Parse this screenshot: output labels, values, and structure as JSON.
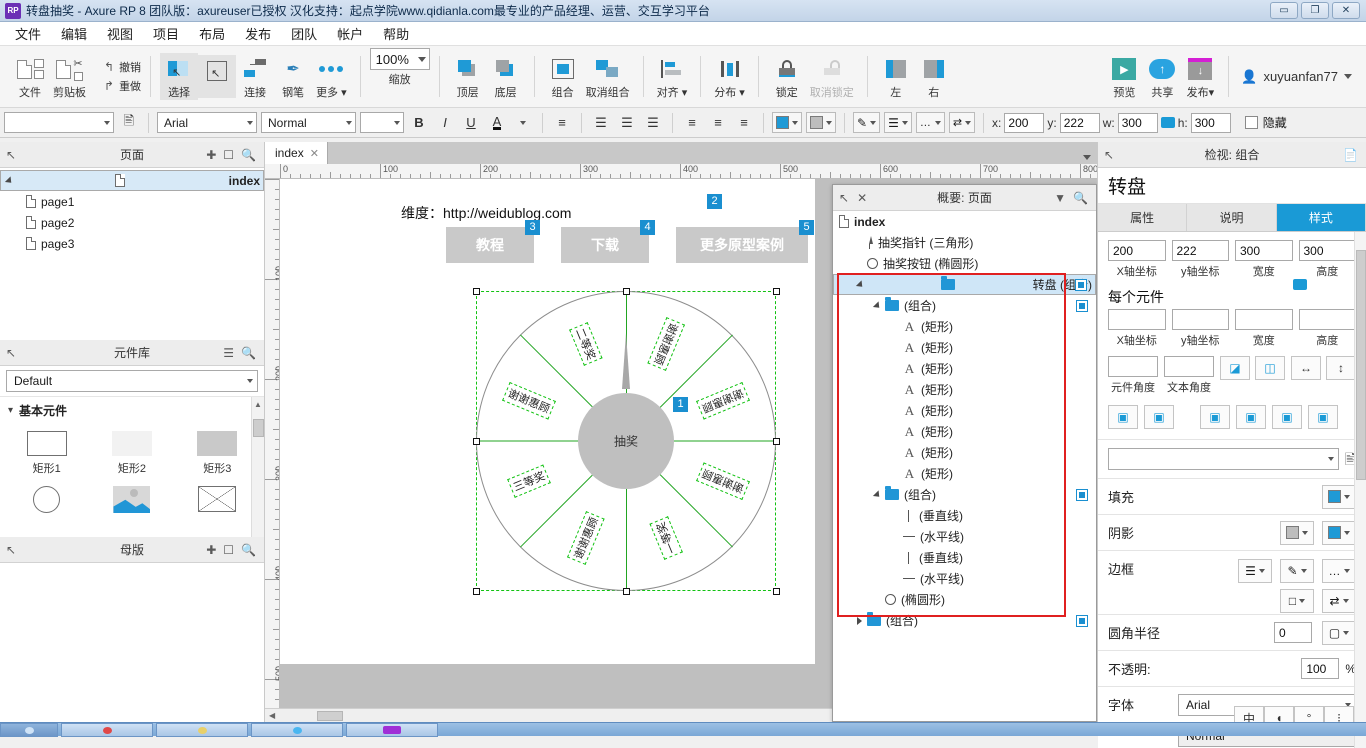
{
  "window": {
    "app_icon": "RP",
    "title": "转盘抽奖 - Axure RP 8 团队版：axureuser已授权 汉化支持：起点学院www.qidianla.com最专业的产品经理、运营、交互学习平台",
    "minimize": "—",
    "maximize": "❐",
    "close": "✕"
  },
  "menu": [
    "文件",
    "编辑",
    "视图",
    "项目",
    "布局",
    "发布",
    "团队",
    "帐户",
    "帮助"
  ],
  "toolbar": {
    "file_label": "文件",
    "clipboard_label": "剪贴板",
    "undo_label": "撤销",
    "redo_label": "重做",
    "select_label": "选择",
    "connect_label": "连接",
    "pen_label": "钢笔",
    "more_label": "更多",
    "zoom_value": "100%",
    "zoom_label": "缩放",
    "front_label": "顶层",
    "back_label": "底层",
    "group_label": "组合",
    "ungroup_label": "取消组合",
    "align_label": "对齐",
    "distribute_label": "分布",
    "lock_label": "锁定",
    "unlock_label": "取消锁定",
    "left_label": "左",
    "right_label": "右",
    "preview_label": "预览",
    "share_label": "共享",
    "publish_label": "发布",
    "user_name": "xuyuanfan77"
  },
  "formatbar": {
    "style_value": "",
    "font_family": "Arial",
    "font_weight": "Normal",
    "font_size": "",
    "bold": "B",
    "italic": "I",
    "underline": "U",
    "font_color": "A",
    "x_label": "x:",
    "x_value": "200",
    "y_label": "y:",
    "y_value": "222",
    "w_label": "w:",
    "w_value": "300",
    "h_label": "h:",
    "h_value": "300",
    "hidden_label": "隐藏"
  },
  "pages_panel": {
    "title": "页面",
    "items": [
      {
        "label": "index",
        "depth": 0,
        "selected": true
      },
      {
        "label": "page1",
        "depth": 1,
        "selected": false
      },
      {
        "label": "page2",
        "depth": 1,
        "selected": false
      },
      {
        "label": "page3",
        "depth": 1,
        "selected": false
      }
    ]
  },
  "libraries_panel": {
    "title": "元件库",
    "selected_library": "Default",
    "group_label": "基本元件",
    "widgets": [
      {
        "name": "矩形1",
        "icon": "rect-outline-icon"
      },
      {
        "name": "矩形2",
        "icon": "rect-light-icon"
      },
      {
        "name": "矩形3",
        "icon": "rect-gray-icon"
      },
      {
        "name": "",
        "icon": "ellipse-icon"
      },
      {
        "name": "",
        "icon": "image-icon"
      },
      {
        "name": "",
        "icon": "placeholder-icon"
      }
    ]
  },
  "masters_panel": {
    "title": "母版"
  },
  "canvas": {
    "tab_label": "index",
    "ruler_h": [
      "0",
      "100",
      "200",
      "300",
      "400",
      "500",
      "600",
      "700",
      "800"
    ],
    "ruler_v": [
      "100",
      "200",
      "300",
      "400",
      "500",
      "600"
    ],
    "header_text": "维度：http://weidublog.com",
    "buttons": [
      {
        "label": "教程",
        "badge": "3"
      },
      {
        "label": "下载",
        "badge": "4"
      },
      {
        "label": "更多原型案例",
        "badge": "5"
      }
    ],
    "header_badge": "2",
    "wheel_badge": "1",
    "hub_label": "抽奖",
    "sectors": [
      "谢谢惠顾",
      "谢谢惠顾",
      "谢谢惠顾",
      "一等奖",
      "谢谢惠顾",
      "三等奖",
      "谢谢惠顾",
      "二等奖"
    ]
  },
  "outline_panel": {
    "title": "概要: 页面",
    "items": [
      {
        "label": "index",
        "icon": "document-icon",
        "depth": 0,
        "selected": false,
        "badge": false
      },
      {
        "label": "抽奖指针 (三角形)",
        "icon": "triangle-icon",
        "depth": 1,
        "selected": false,
        "badge": false
      },
      {
        "label": "抽奖按钮 (椭圆形)",
        "icon": "ellipse-icon",
        "depth": 1,
        "selected": false,
        "badge": false
      },
      {
        "label": "转盘 (组合)",
        "icon": "folder-icon",
        "depth": 1,
        "selected": true,
        "badge": true,
        "twisty": "open"
      },
      {
        "label": "(组合)",
        "icon": "folder-icon",
        "depth": 2,
        "selected": false,
        "badge": true,
        "twisty": "open"
      },
      {
        "label": "(矩形)",
        "icon": "text-icon",
        "depth": 3,
        "selected": false,
        "badge": false
      },
      {
        "label": "(矩形)",
        "icon": "text-icon",
        "depth": 3,
        "selected": false,
        "badge": false
      },
      {
        "label": "(矩形)",
        "icon": "text-icon",
        "depth": 3,
        "selected": false,
        "badge": false
      },
      {
        "label": "(矩形)",
        "icon": "text-icon",
        "depth": 3,
        "selected": false,
        "badge": false
      },
      {
        "label": "(矩形)",
        "icon": "text-icon",
        "depth": 3,
        "selected": false,
        "badge": false
      },
      {
        "label": "(矩形)",
        "icon": "text-icon",
        "depth": 3,
        "selected": false,
        "badge": false
      },
      {
        "label": "(矩形)",
        "icon": "text-icon",
        "depth": 3,
        "selected": false,
        "badge": false
      },
      {
        "label": "(矩形)",
        "icon": "text-icon",
        "depth": 3,
        "selected": false,
        "badge": false
      },
      {
        "label": "(组合)",
        "icon": "folder-icon",
        "depth": 2,
        "selected": false,
        "badge": true,
        "twisty": "open"
      },
      {
        "label": "(垂直线)",
        "icon": "vline-icon",
        "depth": 3,
        "selected": false,
        "badge": false
      },
      {
        "label": "(水平线)",
        "icon": "hline-icon",
        "depth": 3,
        "selected": false,
        "badge": false
      },
      {
        "label": "(垂直线)",
        "icon": "vline-icon",
        "depth": 3,
        "selected": false,
        "badge": false
      },
      {
        "label": "(水平线)",
        "icon": "hline-icon",
        "depth": 3,
        "selected": false,
        "badge": false
      },
      {
        "label": "(椭圆形)",
        "icon": "ellipse-icon",
        "depth": 2,
        "selected": false,
        "badge": false
      },
      {
        "label": "(组合)",
        "icon": "folder-icon",
        "depth": 1,
        "selected": false,
        "badge": true,
        "twisty": "closed"
      }
    ]
  },
  "inspector": {
    "header": "检视: 组合",
    "object_name": "转盘",
    "tabs": [
      {
        "label": "属性",
        "active": false
      },
      {
        "label": "说明",
        "active": false
      },
      {
        "label": "样式",
        "active": true
      }
    ],
    "x_value": "200",
    "y_value": "222",
    "w_value": "300",
    "h_value": "300",
    "x_caption": "X轴坐标",
    "y_caption": "y轴坐标",
    "w_caption": "宽度",
    "h_caption": "高度",
    "each_widget_label": "每个元件",
    "each_x": "",
    "each_y": "",
    "each_w": "",
    "each_h": "",
    "rotation_value": "",
    "text_rotation_value": "",
    "rotation_caption": "元件角度",
    "text_rotation_caption": "文本角度",
    "style_preset": "",
    "fill_label": "填充",
    "shadow_label": "阴影",
    "border_label": "边框",
    "corner_label": "圆角半径",
    "corner_value": "0",
    "opacity_label": "不透明:",
    "opacity_value": "100",
    "opacity_unit": "%",
    "font_label": "字体",
    "font_family": "Arial",
    "font_weight": "Normal",
    "accent_color": "#1a9ad6"
  }
}
